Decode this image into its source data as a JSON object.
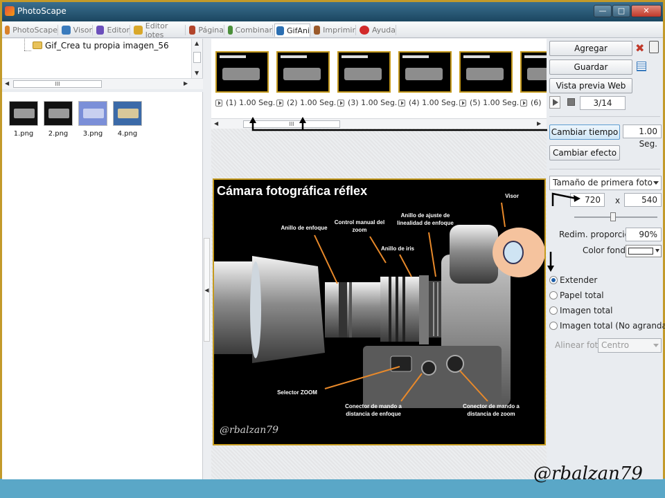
{
  "window": {
    "title": "PhotoScape",
    "min": "—",
    "max": "□",
    "close": "✕"
  },
  "menu": {
    "tabs": [
      {
        "label": "PhotoScape",
        "icon": "photoscape-icon",
        "color": "#d9822b"
      },
      {
        "label": "Visor",
        "icon": "viewer-icon",
        "color": "#3a7bbd"
      },
      {
        "label": "Editor",
        "icon": "editor-icon",
        "color": "#6b4fbb"
      },
      {
        "label": "Editor lotes",
        "icon": "batch-editor-icon",
        "color": "#d9a82b"
      },
      {
        "label": "Página",
        "icon": "page-icon",
        "color": "#b2452b"
      },
      {
        "label": "Combinar",
        "icon": "combine-icon",
        "color": "#4b8f3a"
      },
      {
        "label": "GifAni",
        "icon": "gif-icon",
        "color": "#2b6fb2"
      },
      {
        "label": "Imprimir",
        "icon": "print-icon",
        "color": "#9a5a2b"
      },
      {
        "label": "Ayuda",
        "icon": "help-icon",
        "color": "#d22b2b"
      }
    ]
  },
  "tree": {
    "folder": "Gif_Crea tu propia imagen_56",
    "scroll_thumb": "III"
  },
  "files": [
    {
      "name": "1.png"
    },
    {
      "name": "2.png"
    },
    {
      "name": "3.png"
    },
    {
      "name": "4.png"
    }
  ],
  "frames": {
    "items": [
      {
        "label": "(1) 1.00 Seg."
      },
      {
        "label": "(2) 1.00 Seg."
      },
      {
        "label": "(3) 1.00 Seg."
      },
      {
        "label": "(4) 1.00 Seg."
      },
      {
        "label": "(5) 1.00 Seg."
      },
      {
        "label": "(6)"
      }
    ],
    "scroll_thumb": "III"
  },
  "preview": {
    "title": "Cámara fotográfica réflex",
    "labels": {
      "visor": "Visor",
      "anillo_enfoque": "Anillo de enfoque",
      "control_manual": "Control manual del zoom",
      "anillo_ajuste": "Anillo de ajuste de linealidad de enfoque",
      "anillo_iris": "Anillo de iris",
      "selector_zoom": "Selector ZOOM",
      "conector_enfoque": "Conector de mando a distancia de enfoque",
      "conector_zoom": "Conector de mando a distancia de zoom"
    },
    "watermark": "@rbalzan79"
  },
  "right": {
    "agregar": "Agregar",
    "guardar": "Guardar",
    "vista_previa": "Vista previa Web",
    "frame_counter": "3/14",
    "cambiar_tiempo": "Cambiar tiempo",
    "tiempo_value": "1.00 Seg.",
    "cambiar_efecto": "Cambiar efecto",
    "size_mode": "Tamaño de primera foto",
    "width": "720",
    "x": "x",
    "height": "540",
    "redim_label": "Redim. proporción",
    "redim_value": "90%",
    "color_fondo": "Color fondo",
    "radios": [
      {
        "label": "Extender",
        "checked": true
      },
      {
        "label": "Papel total",
        "checked": false
      },
      {
        "label": "Imagen total",
        "checked": false
      },
      {
        "label": "Imagen total (No agrandada)",
        "checked": false
      }
    ],
    "alinear_label": "Alinear foto",
    "alinear_value": "Centro"
  },
  "watermark": "@rbalzan79"
}
